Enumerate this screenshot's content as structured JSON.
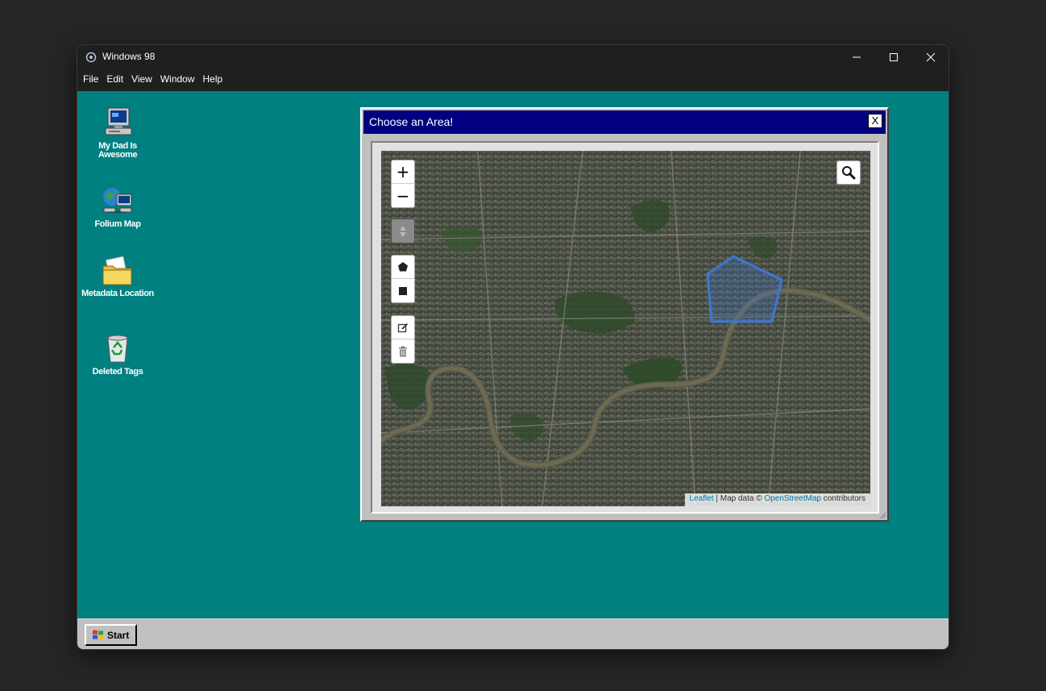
{
  "window": {
    "title": "Windows 98",
    "menu": [
      "File",
      "Edit",
      "View",
      "Window",
      "Help"
    ]
  },
  "desktop": {
    "background": "#008080",
    "icons": [
      {
        "label": "My Dad Is Awesome",
        "icon": "computer-icon"
      },
      {
        "label": "Folium Map",
        "icon": "network-globe-icon"
      },
      {
        "label": "Metadata Location",
        "icon": "folder-icon"
      },
      {
        "label": "Deleted Tags",
        "icon": "recycle-bin-icon"
      }
    ]
  },
  "dialog": {
    "title": "Choose an Area!",
    "close_label": "X",
    "title_color": "#000080"
  },
  "map": {
    "controls": {
      "zoom_in": "+",
      "zoom_out": "−",
      "draw_tools": [
        "polyline-icon",
        "polygon-icon",
        "rectangle-icon",
        "edit-icon",
        "delete-icon"
      ],
      "search": "search-icon"
    },
    "polygon_color": "#3a78d8",
    "attribution": {
      "leaflet": "Leaflet",
      "separator": " | Map data © ",
      "osm": "OpenStreetMap",
      "suffix": " contributors"
    }
  },
  "taskbar": {
    "start_label": "Start"
  }
}
